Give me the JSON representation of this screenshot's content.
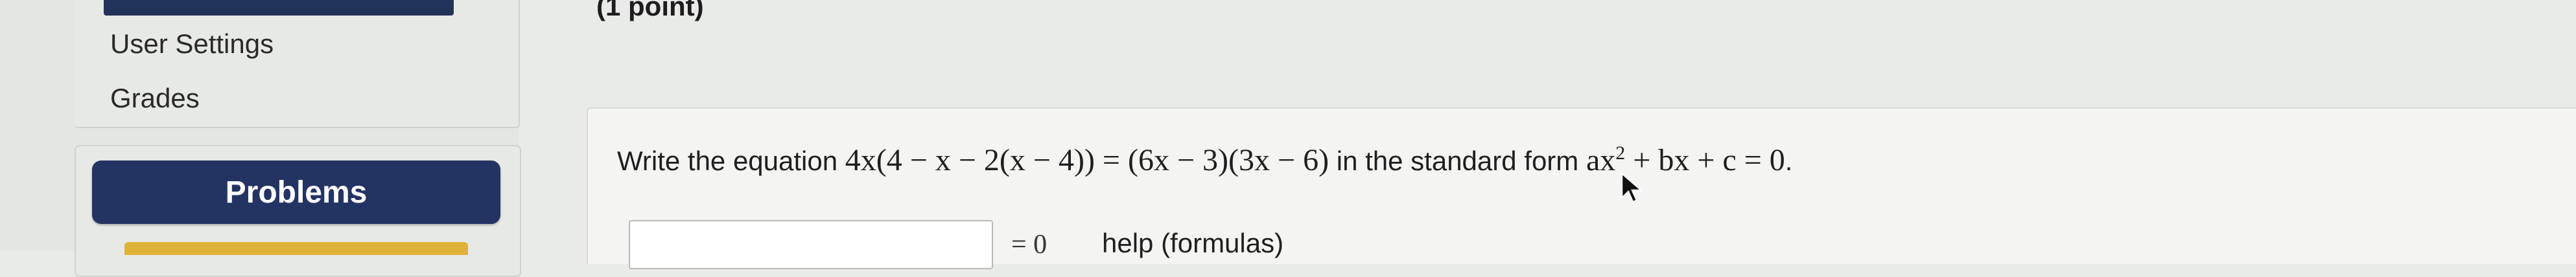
{
  "sidebar": {
    "items": [
      {
        "label": "User Settings"
      },
      {
        "label": "Grades"
      }
    ],
    "problems_button_label": "Problems"
  },
  "problem": {
    "points_label": "(1 point)",
    "prompt_prefix": "Write the equation ",
    "equation": "4x(4 − x − 2(x − 4)) = (6x − 3)(3x − 6)",
    "prompt_middle": " in the standard form ",
    "standard_form_lhs": "ax",
    "standard_form_exp": "2",
    "standard_form_rhs": " + bx + c = 0",
    "prompt_suffix": ".",
    "answer_value": "",
    "equals_zero": "= 0",
    "help_label": "help (formulas)"
  },
  "colors": {
    "nav_button": "#233463",
    "accent_strip": "#e0b23a",
    "background": "#e9ebe8"
  },
  "icons": {
    "cursor": "mouse-pointer-icon"
  }
}
